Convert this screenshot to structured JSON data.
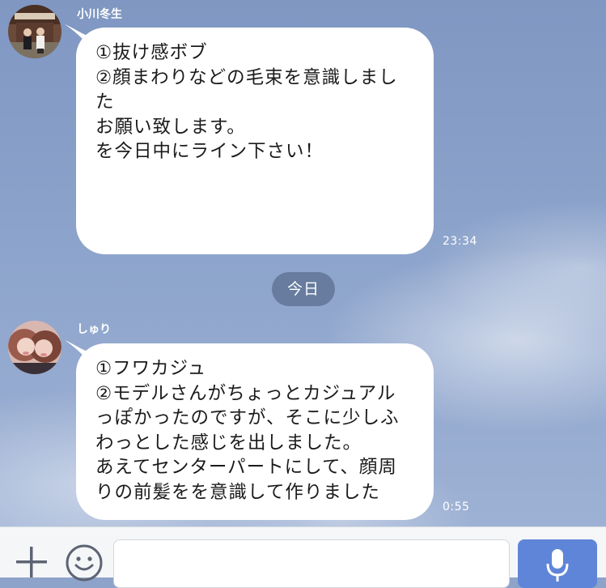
{
  "messages": [
    {
      "sender": "小川冬生",
      "lines": [
        "①抜け感ボブ",
        "",
        "②顔まわりなどの毛束を意識しまし",
        "た",
        "",
        "お願い致します。",
        "",
        "を今日中にライン下さい！"
      ],
      "time": "23:34",
      "avatar_icon": "profile-photo-icon"
    },
    {
      "sender": "しゅり",
      "lines": [
        "①フワカジュ",
        "②モデルさんがちょっとカジュアル",
        "っぽかったのですが、そこに少しふ",
        "わっとした感じを出しました。",
        "あえてセンターパートにして、顔周",
        "りの前髪をを意識して作りました"
      ],
      "time": "0:55",
      "avatar_icon": "profile-photo-icon"
    }
  ],
  "date_separator": "今日",
  "input_bar": {
    "plus_icon": "plus-icon",
    "emoji_icon": "emoji-icon",
    "message_value": "",
    "mic_icon": "microphone-icon"
  },
  "colors": {
    "mic_button": "#5f85d8",
    "date_chip": "#607496",
    "bubble": "#ffffff"
  }
}
